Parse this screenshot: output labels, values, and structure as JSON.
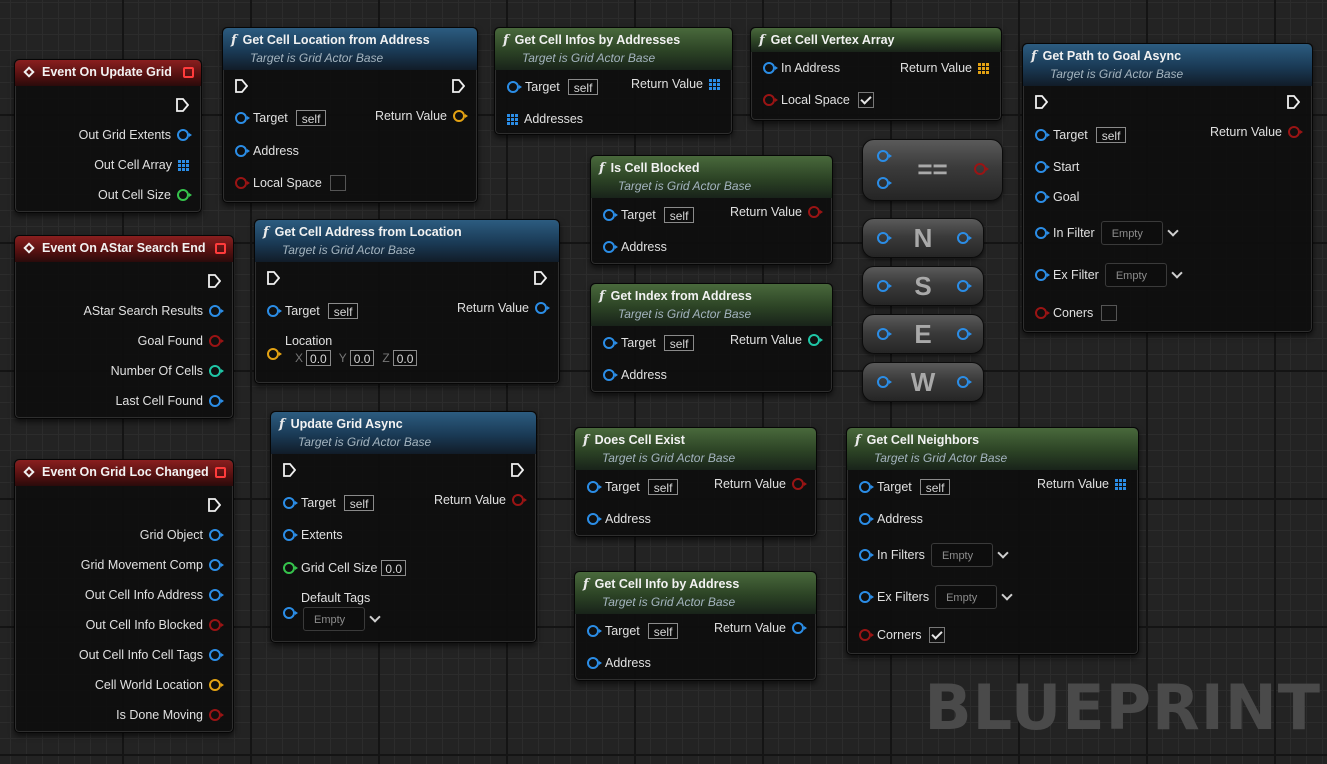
{
  "target_note": "Target is Grid Actor Base",
  "self_text": "self",
  "empty_text": "Empty",
  "zero_value": "0.0",
  "axis_x": "X",
  "axis_y": "Y",
  "axis_z": "Z",
  "watermark": "BLUEPRINT",
  "pin_colors": {
    "object": "#2b8de6",
    "bool": "#9a1414",
    "vector": "#e3a213",
    "float": "#36c34c",
    "int": "#1fc6a6"
  },
  "event_update_grid": {
    "title": "Event On Update Grid",
    "pins": [
      "Out Grid Extents",
      "Out Cell Array",
      "Out Cell Size"
    ]
  },
  "event_astar": {
    "title": "Event On AStar Search End",
    "pins": [
      "AStar Search Results",
      "Goal Found",
      "Number Of Cells",
      "Last Cell Found"
    ]
  },
  "event_grid_loc": {
    "title": "Event On Grid Loc Changed",
    "pins": [
      "Grid Object",
      "Grid Movement Comp",
      "Out Cell Info Address",
      "Out Cell Info Blocked",
      "Out Cell Info Cell Tags",
      "Cell World Location",
      "Is Done Moving"
    ]
  },
  "get_cell_location": {
    "title": "Get Cell Location from Address",
    "target": "Target",
    "return": "Return Value",
    "address": "Address",
    "local_space": "Local Space"
  },
  "get_cell_infos": {
    "title": "Get Cell Infos by Addresses",
    "target": "Target",
    "return": "Return Value",
    "addresses": "Addresses"
  },
  "get_vertex_array": {
    "title": "Get Cell Vertex Array",
    "in_address": "In Address",
    "return": "Return Value",
    "local_space": "Local Space"
  },
  "get_path": {
    "title": "Get Path to Goal Async",
    "target": "Target",
    "return": "Return Value",
    "start": "Start",
    "goal": "Goal",
    "in_filter": "In Filter",
    "ex_filter": "Ex Filter",
    "coners": "Coners"
  },
  "get_cell_address": {
    "title": "Get Cell Address from Location",
    "target": "Target",
    "return": "Return Value",
    "location": "Location"
  },
  "is_cell_blocked": {
    "title": "Is Cell Blocked",
    "target": "Target",
    "return": "Return Value",
    "address": "Address"
  },
  "get_index": {
    "title": "Get Index from Address",
    "target": "Target",
    "return": "Return Value",
    "address": "Address"
  },
  "equals": {
    "symbol": "=="
  },
  "dirs": [
    "N",
    "S",
    "E",
    "W"
  ],
  "update_grid": {
    "title": "Update Grid Async",
    "target": "Target",
    "return": "Return Value",
    "extents": "Extents",
    "cell_size": "Grid Cell Size",
    "default_tags": "Default Tags"
  },
  "does_cell_exist": {
    "title": "Does Cell Exist",
    "target": "Target",
    "return": "Return Value",
    "address": "Address"
  },
  "get_cell_info": {
    "title": "Get Cell Info by Address",
    "target": "Target",
    "return": "Return Value",
    "address": "Address"
  },
  "get_neighbors": {
    "title": "Get Cell Neighbors",
    "target": "Target",
    "return": "Return Value",
    "address": "Address",
    "in_filters": "In Filters",
    "ex_filters": "Ex Filters",
    "corners": "Corners"
  }
}
